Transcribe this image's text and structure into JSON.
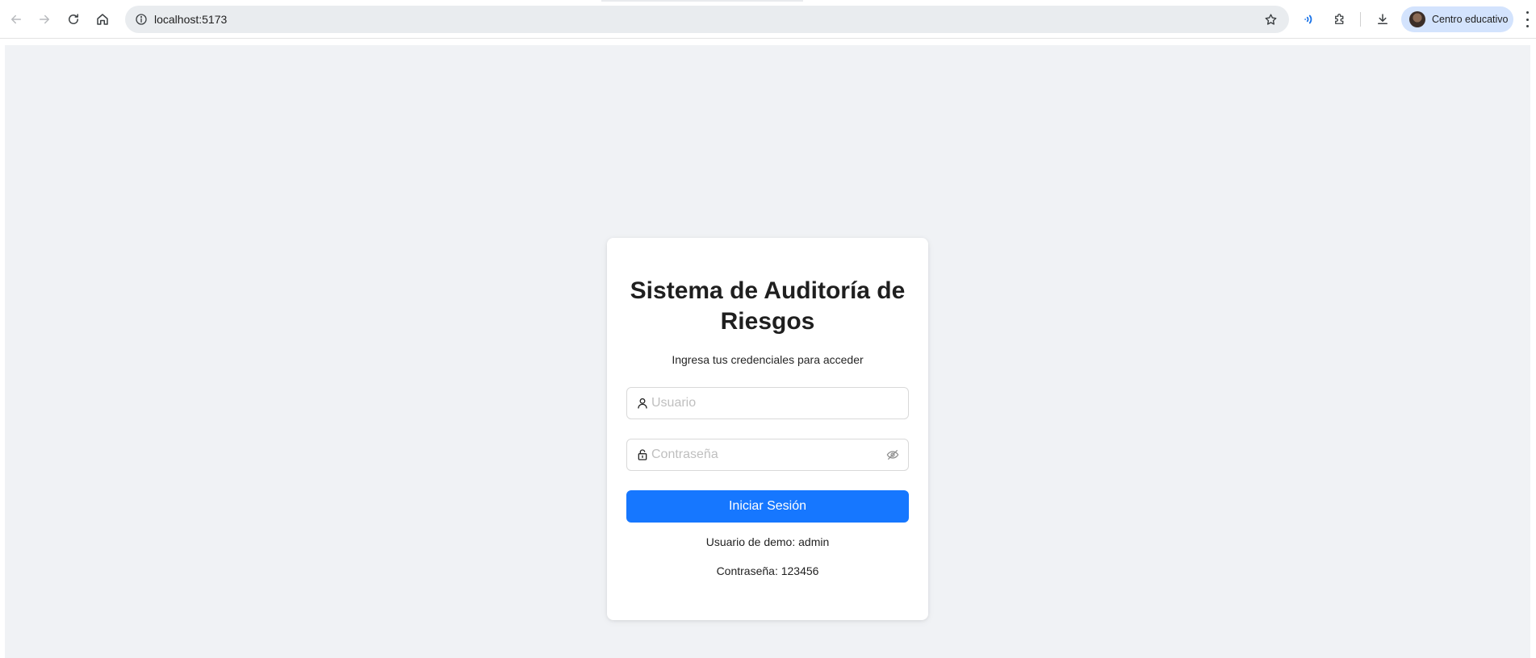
{
  "browser": {
    "url": "localhost:5173",
    "profile_name": "Centro educativo",
    "icons": {
      "back": "arrow-left-icon",
      "forward": "arrow-right-icon",
      "reload": "reload-icon",
      "home": "home-icon",
      "site_info": "info-icon",
      "bookmark": "star-icon",
      "extension_audio": "sound-wave-icon",
      "extensions": "puzzle-icon",
      "downloads": "download-icon",
      "menu": "kebab-menu-icon"
    }
  },
  "login": {
    "title": "Sistema de Auditoría de Riesgos",
    "subtitle": "Ingresa tus credenciales para acceder",
    "username_placeholder": "Usuario",
    "password_placeholder": "Contraseña",
    "submit_label": "Iniciar Sesión",
    "demo_user": "Usuario de demo: admin",
    "demo_password": "Contraseña: 123456"
  },
  "colors": {
    "primary": "#1677ff",
    "page_background": "#f0f2f5",
    "card_background": "#ffffff"
  }
}
